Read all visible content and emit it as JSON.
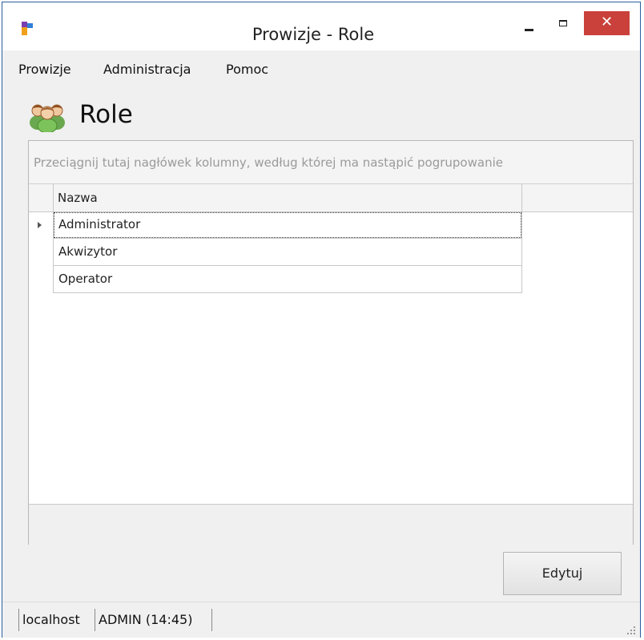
{
  "window": {
    "title": "Prowizje - Role",
    "close_glyph": "✕"
  },
  "menu": {
    "items": [
      "Prowizje",
      "Administracja",
      "Pomoc"
    ]
  },
  "page": {
    "title": "Role",
    "icon": "users-group-icon"
  },
  "grid": {
    "group_panel_hint": "Przeciągnij tutaj nagłówek kolumny, według której ma nastąpić pogrupowanie",
    "columns": [
      "Nazwa"
    ],
    "rows": [
      {
        "name": "Administrator",
        "current": true
      },
      {
        "name": "Akwizytor",
        "current": false
      },
      {
        "name": "Operator",
        "current": false
      }
    ]
  },
  "actions": {
    "edit_label": "Edytuj"
  },
  "status": {
    "server": "localhost",
    "user": "ADMIN (14:45)"
  },
  "colors": {
    "close_button": "#c9413a",
    "window_border": "#2a5d9f"
  }
}
